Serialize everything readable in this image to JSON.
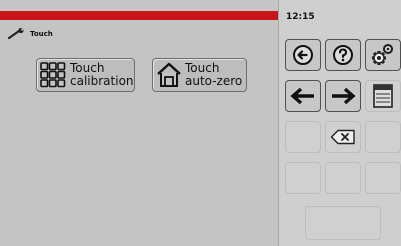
{
  "status_bar": {
    "time": "12:15"
  },
  "breadcrumb": {
    "label": "Touch"
  },
  "tiles": [
    {
      "label": "Touch\ncalibration",
      "icon": "keypad-grid-icon"
    },
    {
      "label": "Touch\nauto-zero",
      "icon": "home-icon"
    }
  ],
  "keypad": {
    "buttons": [
      {
        "name": "back-button",
        "icon": "back-circle-icon"
      },
      {
        "name": "help-button",
        "icon": "help-circle-icon"
      },
      {
        "name": "settings-button",
        "icon": "gears-icon"
      },
      {
        "name": "left-arrow-button",
        "icon": "arrow-left-icon"
      },
      {
        "name": "right-arrow-button",
        "icon": "arrow-right-icon"
      },
      {
        "name": "panel-button",
        "icon": "panel-icon"
      },
      {
        "name": "backspace-button",
        "icon": "backspace-icon"
      }
    ]
  },
  "colors": {
    "accent": "#c8161a",
    "background": "#c6c6c6",
    "panel": "#cfcfcf"
  }
}
